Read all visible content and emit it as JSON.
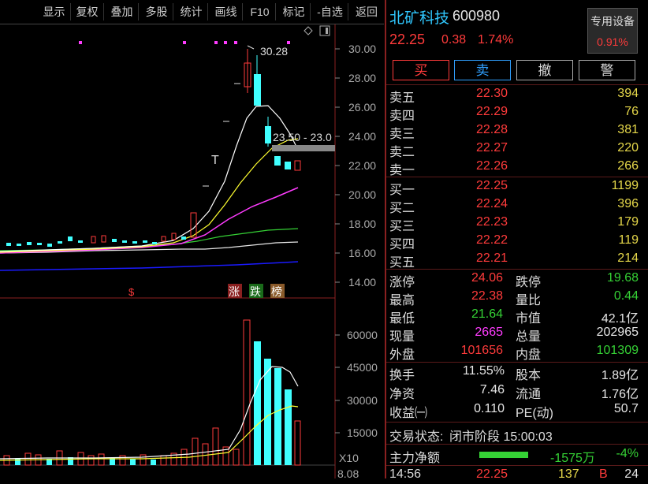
{
  "toolbar": {
    "items": [
      "显示",
      "复权",
      "叠加",
      "多股",
      "统计",
      "画线",
      "F10",
      "标记",
      "-自选",
      "返回"
    ]
  },
  "chart": {
    "price_axis": [
      "30.00",
      "28.00",
      "26.00",
      "24.00",
      "22.00",
      "20.00",
      "18.00",
      "16.00",
      "14.00"
    ],
    "vol_axis": [
      "60000",
      "45000",
      "30000",
      "15000"
    ],
    "vol_unit": "X10",
    "high_label": "30.28",
    "range_label": "23.50 - 23.0",
    "t_mark": "T",
    "s_mark": "$",
    "badges": [
      "涨",
      "跌",
      "榜"
    ],
    "bottom_value": "8.08"
  },
  "stock": {
    "name": "北矿科技",
    "code": "600980",
    "price": "22.25",
    "change": "0.38",
    "pct": "1.74%",
    "device_label": "专用设备",
    "device_pct": "0.91%"
  },
  "trade_buttons": [
    "买",
    "卖",
    "撤",
    "警"
  ],
  "asks": [
    {
      "label": "卖五",
      "price": "22.30",
      "vol": "394"
    },
    {
      "label": "卖四",
      "price": "22.29",
      "vol": "76"
    },
    {
      "label": "卖三",
      "price": "22.28",
      "vol": "381"
    },
    {
      "label": "卖二",
      "price": "22.27",
      "vol": "220"
    },
    {
      "label": "卖一",
      "price": "22.26",
      "vol": "266"
    }
  ],
  "bids": [
    {
      "label": "买一",
      "price": "22.25",
      "vol": "1199"
    },
    {
      "label": "买二",
      "price": "22.24",
      "vol": "396"
    },
    {
      "label": "买三",
      "price": "22.23",
      "vol": "179"
    },
    {
      "label": "买四",
      "price": "22.22",
      "vol": "119"
    },
    {
      "label": "买五",
      "price": "22.21",
      "vol": "214"
    }
  ],
  "stats": [
    {
      "l1": "涨停",
      "v1": "24.06",
      "l2": "跌停",
      "v2": "19.68"
    },
    {
      "l1": "最高",
      "v1": "22.38",
      "l2": "量比",
      "v2": "0.44"
    },
    {
      "l1": "最低",
      "v1": "21.64",
      "l2": "市值",
      "v2": "42.1亿"
    },
    {
      "l1": "现量",
      "v1": "2665",
      "l2": "总量",
      "v2": "202965"
    },
    {
      "l1": "外盘",
      "v1": "101656",
      "l2": "内盘",
      "v2": "101309"
    }
  ],
  "fund": [
    {
      "l1": "换手",
      "v1": "11.55%",
      "l2": "股本",
      "v2": "1.89亿"
    },
    {
      "l1": "净资",
      "v1": "7.46",
      "l2": "流通",
      "v2": "1.76亿"
    },
    {
      "l1": "收益㈠",
      "v1": "0.110",
      "l2": "PE(动)",
      "v2": "50.7"
    }
  ],
  "status": {
    "label": "交易状态:",
    "value": "闭市阶段 15:00:03"
  },
  "main_flow": {
    "label": "主力净额",
    "value": "-1575万",
    "pct": "-4%"
  },
  "tick": {
    "time": "14:56",
    "price": "22.25",
    "vol": "137",
    "dir": "B",
    "count": "24"
  },
  "colors": {
    "up": "#ff3b3b",
    "down": "#35d135",
    "accent": "#8a2020"
  }
}
